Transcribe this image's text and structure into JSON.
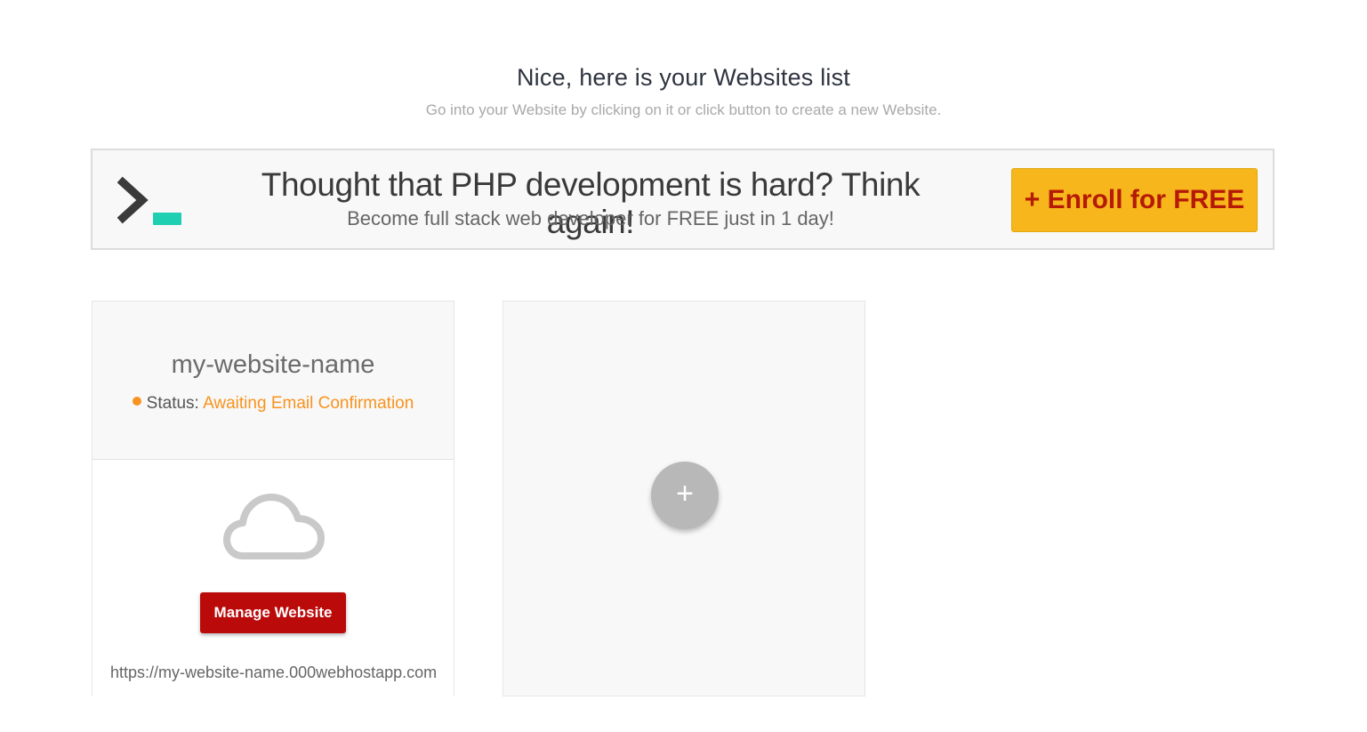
{
  "header": {
    "title": "Nice, here is your Websites list",
    "subtitle": "Go into your Website by clicking on it or click button to create a new Website."
  },
  "banner": {
    "logo_icon": "terminal-prompt-icon",
    "title": "Thought that PHP development is hard? Think again!",
    "subtitle": "Become full stack web developer for FREE just in 1 day!",
    "cta_label": "+ Enroll for FREE",
    "cta_color": "#f6b61c",
    "cta_text_color": "#b51a06"
  },
  "websites": [
    {
      "name": "my-website-name",
      "status_label": "Status:",
      "status_value": "Awaiting Email Confirmation",
      "status_color": "#f7931e",
      "icon": "cloud-icon",
      "manage_label": "Manage Website",
      "manage_color": "#bb0a0a",
      "url": "https://my-website-name.000webhostapp.com"
    }
  ],
  "add_card": {
    "icon": "plus-icon",
    "label": "+"
  }
}
